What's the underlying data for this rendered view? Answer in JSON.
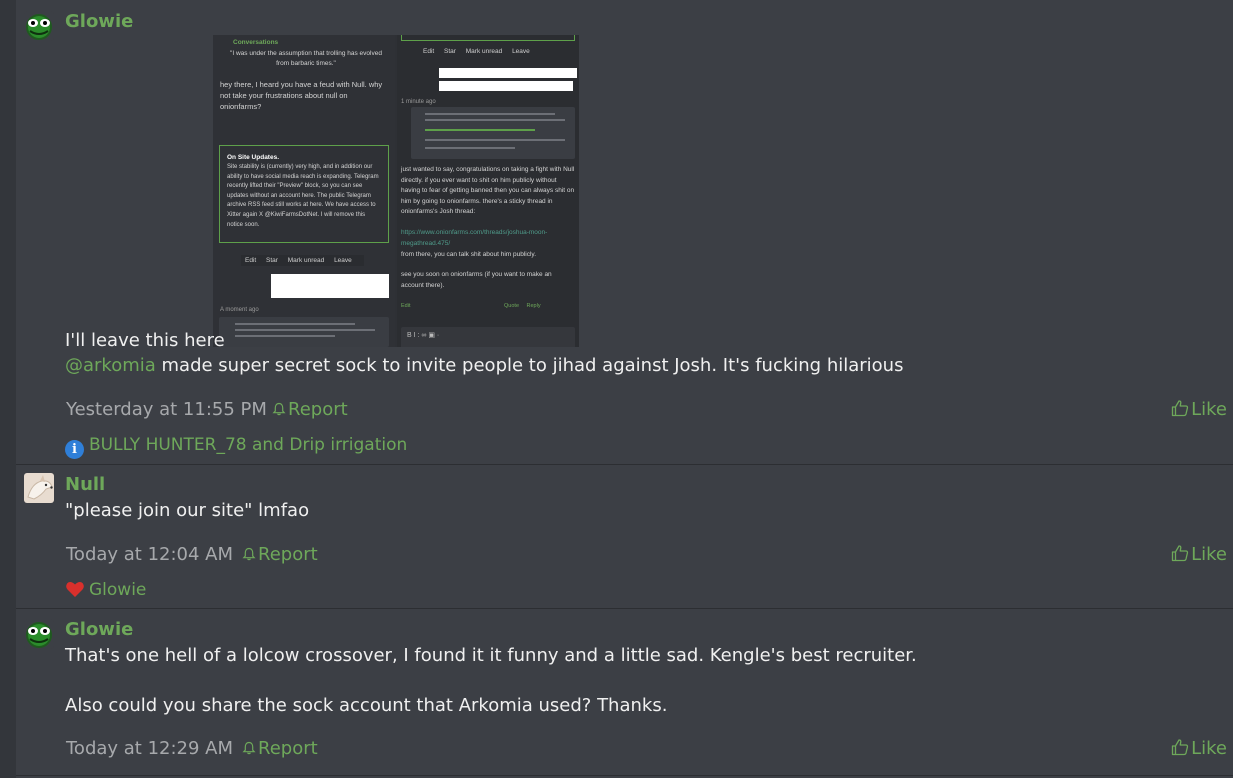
{
  "posts": [
    {
      "username": "Glowie",
      "text_before_image": "I'll leave this here",
      "mention": "@arkomia",
      "text_after_mention": " made super secret sock to invite people to jihad against Josh. It's fucking hilarious",
      "timestamp": "Yesterday at 11:55 PM",
      "report_label": "Report",
      "like_label": "Like",
      "reactions_text": "BULLY HUNTER_78 and Drip irrigation",
      "avatar_icon": "green-frog-avatar"
    },
    {
      "username": "Null",
      "text": "\"please join our site\" lmfao",
      "timestamp": "Today at 12:04 AM",
      "report_label": "Report",
      "like_label": "Like",
      "reactions_text": "Glowie",
      "avatar_icon": "dog-avatar"
    },
    {
      "username": "Glowie",
      "text_line1": "That's one hell of a lolcow crossover, I found it it funny and a little sad. Kengle's best recruiter.",
      "text_line2": "Also could you share the sock account that Arkomia used? Thanks.",
      "timestamp": "Today at 12:29 AM",
      "report_label": "Report",
      "like_label": "Like",
      "avatar_icon": "green-frog-avatar"
    }
  ],
  "embedded_screenshot": {
    "left": {
      "header": "Conversations",
      "quote": "\"I was under the assumption that trolling has evolved from barbaric times.\"",
      "message": "hey there, I heard you have a feud with Null. why not take your frustrations about null on onionfarms?",
      "notice_title": "On Site Updates.",
      "notice_body": "Site stability is (currently) very high, and in addition our ability to have social media reach is expanding. Telegram recently lifted their \"Preview\" block, so you can see updates without an account here. The public Telegram archive RSS feed still works at here. We have access to Xitter again X @KiwiFarmsDotNet. I will remove this notice soon.",
      "toolbar": [
        "Edit",
        "Star",
        "Mark unread",
        "Leave"
      ],
      "time": "A moment ago"
    },
    "right": {
      "toolbar": [
        "Edit",
        "Star",
        "Mark unread",
        "Leave"
      ],
      "time": "1 minute ago",
      "message": "just wanted to say, congratulations on taking a fight with Null directly. if you ever want to shit on him publicly without having to fear of getting banned then you can always shit on him by going to onionfarms. there's a sticky thread in onionfarms's Josh thread:",
      "link": "https://www.onionfarms.com/threads/joshua-moon-megathread.475/",
      "message2": "from there, you can talk shit about him publicly.",
      "message3": "see you soon on onionfarms (if you want to make an account there).",
      "actions": [
        "Edit",
        "Quote",
        "Reply"
      ]
    }
  },
  "colors": {
    "accent": "#6ea85a",
    "background": "#3c3f45",
    "text": "#f0f0f0",
    "muted": "#a7a9ac",
    "info": "#2f7fd8",
    "heart": "#d9302c"
  }
}
